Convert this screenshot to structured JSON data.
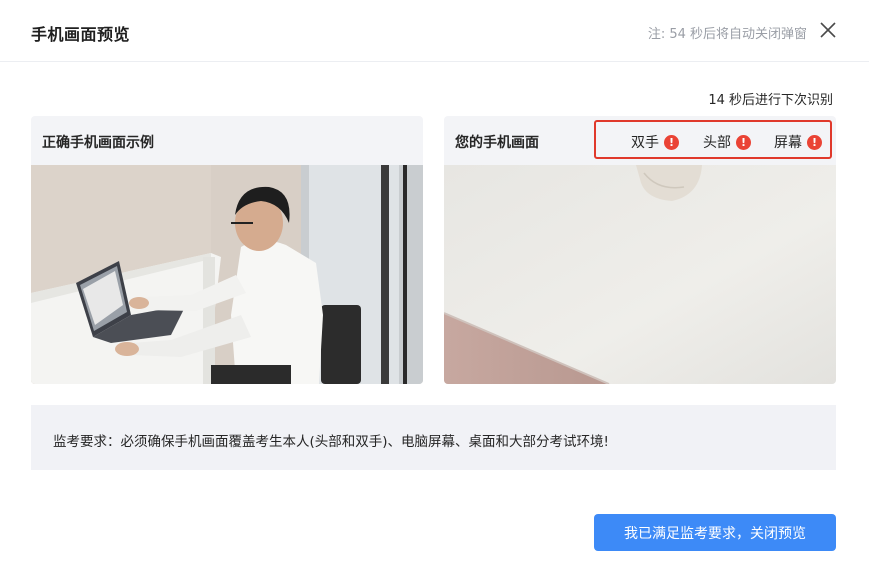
{
  "dialog": {
    "title": "手机画面预览",
    "auto_close_text": "注: 54 秒后将自动关闭弹窗",
    "close_icon": "close-icon"
  },
  "countdown_text": "14 秒后进行下次识别",
  "example_panel": {
    "title": "正确手机画面示例",
    "image_description_icon": "person-at-laptop-photo"
  },
  "user_panel": {
    "title": "您的手机画面",
    "statuses": [
      {
        "label": "双手",
        "icon": "warning-icon",
        "color": "#ea4335"
      },
      {
        "label": "头部",
        "icon": "warning-icon",
        "color": "#ea4335"
      },
      {
        "label": "屏幕",
        "icon": "warning-icon",
        "color": "#ea4335"
      }
    ]
  },
  "requirement_text": "监考要求：必须确保手机画面覆盖考生本人(头部和双手)、电脑屏幕、桌面和大部分考试环境!",
  "confirm_button_label": "我已满足监考要求，关闭预览",
  "colors": {
    "primary": "#3d8af7",
    "alert": "#e0392b",
    "panel_bg": "#f3f4f7"
  }
}
